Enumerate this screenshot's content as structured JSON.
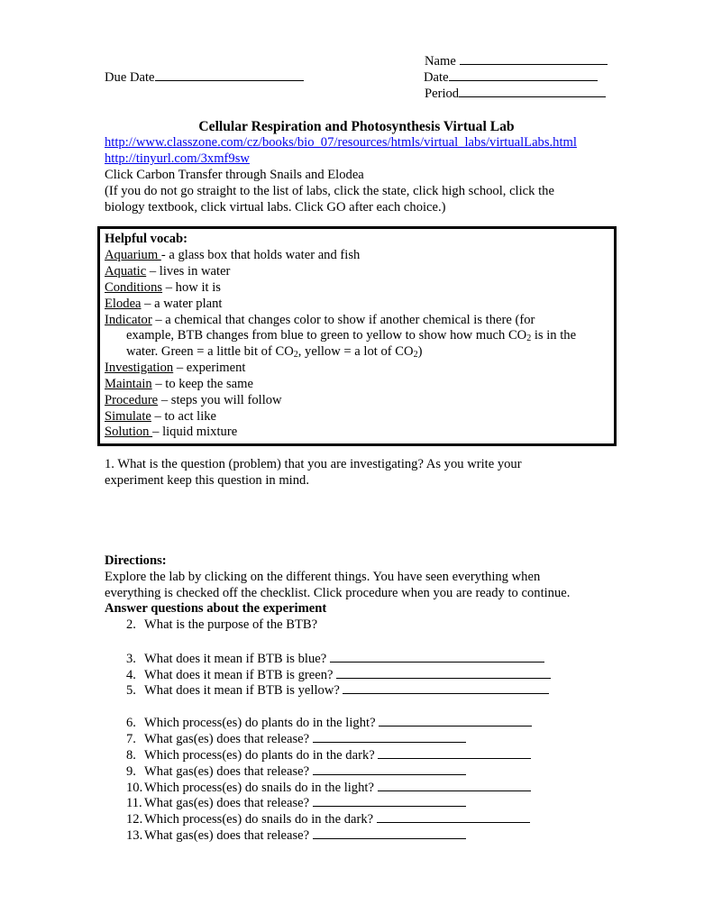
{
  "header": {
    "name_label": "Name",
    "date_label": "Date",
    "period_label": "Period",
    "due_date_label": "Due Date"
  },
  "title": "Cellular Respiration and Photosynthesis Virtual Lab",
  "links": [
    "http://www.classzone.com/cz/books/bio_07/resources/htmls/virtual_labs/virtualLabs.html",
    "http://tinyurl.com/3xmf9sw"
  ],
  "intro": {
    "line1": "Click Carbon Transfer through Snails and Elodea",
    "line2": "(If you do not go straight to the list of labs, click the state, click high school, click the",
    "line3": "biology textbook, click virtual labs.  Click GO after each choice.)"
  },
  "vocab": {
    "heading": "Helpful vocab:",
    "items": [
      {
        "term": "Aquarium ",
        "def": " - a glass box that holds water and fish"
      },
      {
        "term": "Aquatic",
        "def": " – lives in water"
      },
      {
        "term": "Conditions",
        "def": " – how it is"
      },
      {
        "term": "Elodea",
        "def": " – a water plant"
      },
      {
        "term": "Indicator",
        "def": " – a chemical that changes color to show if another chemical is there (for"
      },
      {
        "term": "Investigation",
        "def": " – experiment"
      },
      {
        "term": "Maintain",
        "def": " – to keep the same"
      },
      {
        "term": "Procedure",
        "def": " – steps you will follow"
      },
      {
        "term": "Simulate",
        "def": " – to act like"
      },
      {
        "term": "Solution ",
        "def": " – liquid mixture"
      }
    ],
    "indicator_cont1a": "example, BTB changes from blue to green to yellow to show how much CO",
    "indicator_cont1b": " is in the",
    "indicator_cont2a": "water. Green = a little bit of CO",
    "indicator_cont2b": ", yellow = a lot of CO",
    "indicator_cont2c": ")",
    "subscript": "2"
  },
  "question1": {
    "line1": "1. What is the question (problem) that you are investigating?  As you write your",
    "line2": "experiment keep this question in mind."
  },
  "directions": {
    "heading": "Directions:",
    "line1": "Explore the lab by clicking on the different things.  You have seen everything when",
    "line2": "everything is checked off the checklist.  Click procedure when you are ready to continue.",
    "subheading": "Answer questions about the experiment"
  },
  "questions": [
    {
      "num": "2.",
      "text": "What is the purpose of the BTB?"
    },
    {
      "num": "3.",
      "text": "What does it mean if BTB is blue? "
    },
    {
      "num": "4.",
      "text": "What does it mean if BTB is green? "
    },
    {
      "num": "5.",
      "text": "What does it mean if BTB is yellow? "
    },
    {
      "num": "6.",
      "text": "Which process(es) do plants do in the light? "
    },
    {
      "num": "7.",
      "text": "What gas(es) does that release? "
    },
    {
      "num": "8.",
      "text": "Which process(es) do plants do in the dark? "
    },
    {
      "num": "9.",
      "text": "What gas(es) does that release? "
    },
    {
      "num": "10.",
      "text": "Which process(es) do snails do in the light? "
    },
    {
      "num": "11.",
      "text": "What gas(es) does that release? "
    },
    {
      "num": "12.",
      "text": "Which process(es) do snails do in the dark? "
    },
    {
      "num": "13.",
      "text": "What gas(es) does that release? "
    }
  ]
}
